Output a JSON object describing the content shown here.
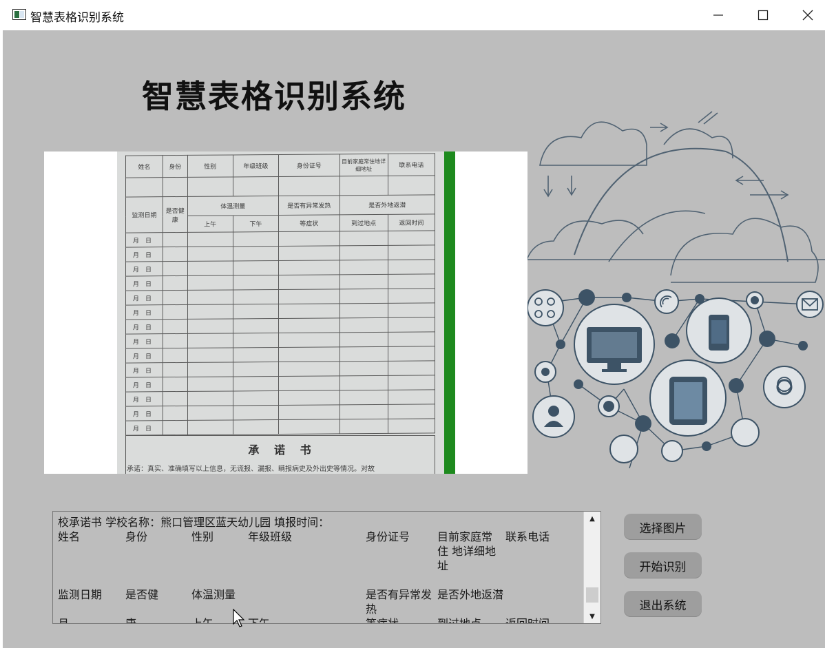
{
  "window": {
    "title": "智慧表格识别系统",
    "controls": {
      "minimize": "minimize-icon",
      "maximize": "maximize-icon",
      "close": "close-icon"
    }
  },
  "header": {
    "title": "智慧表格识别系统"
  },
  "image_preview": {
    "form": {
      "row1": [
        "姓名",
        "身份",
        "性别",
        "年级班级",
        "身份证号",
        "目前家庭常住地详细地址",
        "联系电话"
      ],
      "row2a": [
        "监测日期",
        "是否健康",
        "体温测量",
        "是否有异常发热",
        "是否外地返潜"
      ],
      "row2b": [
        "上午",
        "下午",
        "等症状",
        "到过地点",
        "返回时间"
      ],
      "date_cells": [
        "月　日",
        "月　日",
        "月　日",
        "月　日",
        "月　日",
        "月　日",
        "月　日",
        "月　日",
        "月　日",
        "月　日",
        "月　日",
        "月　日",
        "月　日",
        "月　日"
      ],
      "promise_title": "承 诺 书",
      "promise_text": "承诺：真实、准确填写以上信息，无谎报、漏报、瞒报病史及外出史等情况。对故"
    }
  },
  "result": {
    "lines": [
      [
        "校承诺书 学校名称：熊口管理区蓝天幼儿园  填报时间："
      ],
      [
        "姓名",
        "身份",
        "性别",
        "年级班级",
        "身份证号",
        "目前家庭常",
        "联系电话"
      ],
      [
        "",
        "",
        "",
        "",
        "",
        "住 地详细地",
        ""
      ],
      [
        "",
        "",
        "",
        "",
        "",
        "址",
        ""
      ],
      [
        "",
        "",
        "",
        "",
        "",
        "",
        ""
      ],
      [
        "监测日期",
        "是否健",
        "体温测量",
        "",
        "是否有异常发",
        "是否外地返潜",
        ""
      ],
      [
        "",
        "",
        "",
        "",
        "热",
        "",
        ""
      ],
      [
        "月",
        "康",
        "上午",
        "下午",
        "等症状",
        "到过地点",
        "返回时间"
      ]
    ]
  },
  "buttons": {
    "select_image": "选择图片",
    "start_recognition": "开始识别",
    "exit_system": "退出系统"
  },
  "colors": {
    "background": "#bdbdbd",
    "button": "#9e9e9e",
    "illustration": "#3d5366"
  }
}
